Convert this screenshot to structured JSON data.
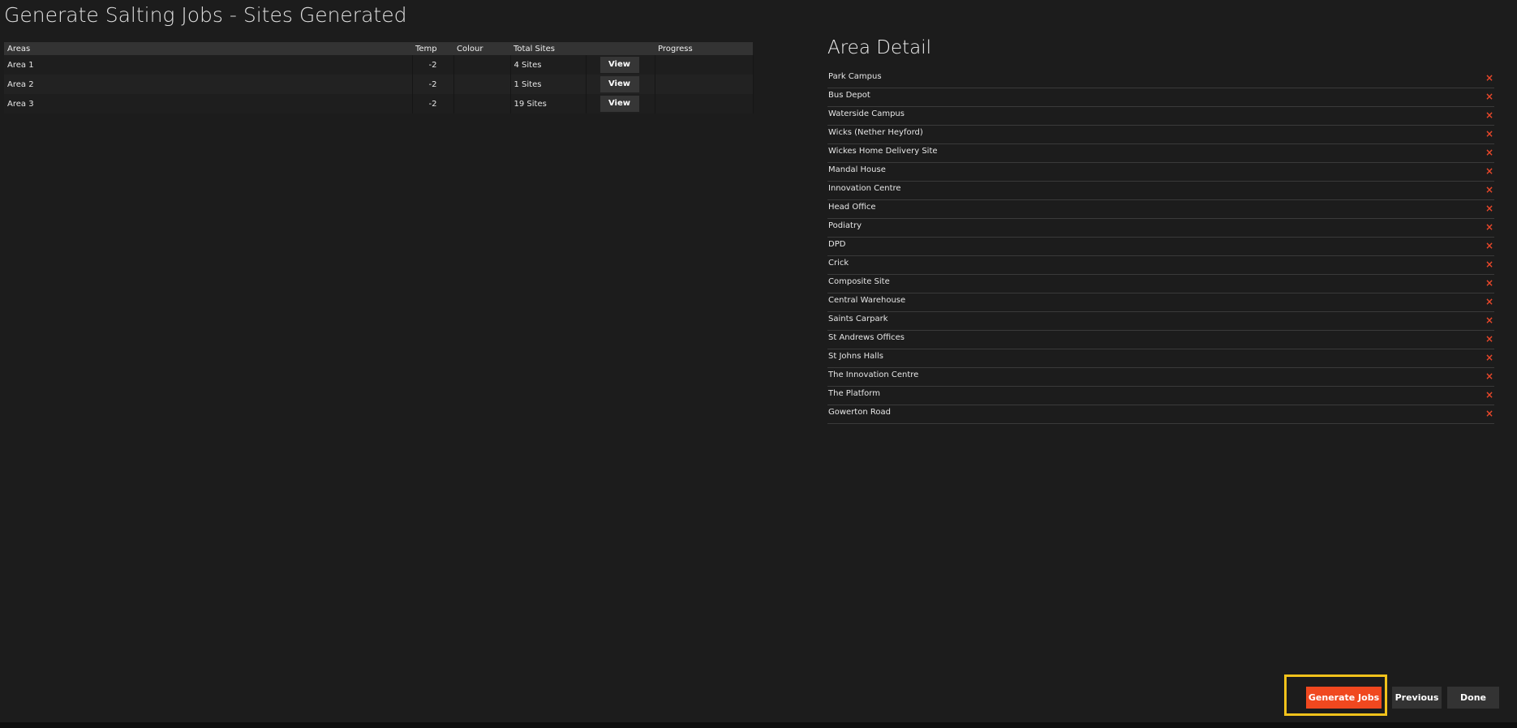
{
  "page": {
    "title": "Generate Salting Jobs - Sites Generated"
  },
  "areas_table": {
    "headers": {
      "areas": "Areas",
      "temp": "Temp",
      "colour": "Colour",
      "total_sites": "Total Sites",
      "action": "",
      "progress": "Progress"
    },
    "rows": [
      {
        "area": "Area 1",
        "temp": "-2",
        "colour": "",
        "total_sites": "4 Sites",
        "view_label": "View",
        "progress": ""
      },
      {
        "area": "Area 2",
        "temp": "-2",
        "colour": "",
        "total_sites": "1 Sites",
        "view_label": "View",
        "progress": ""
      },
      {
        "area": "Area 3",
        "temp": "-2",
        "colour": "",
        "total_sites": "19 Sites",
        "view_label": "View",
        "progress": ""
      }
    ]
  },
  "area_detail": {
    "title": "Area Detail",
    "remove_glyph": "×",
    "sites": [
      "Park Campus",
      "Bus Depot",
      "Waterside Campus",
      "Wicks (Nether Heyford)",
      "Wickes Home Delivery Site",
      "Mandal House",
      "Innovation Centre",
      "Head Office",
      "Podiatry",
      "DPD",
      "Crick",
      "Composite Site",
      "Central Warehouse",
      "Saints Carpark",
      "St Andrews Offices",
      "St Johns Halls",
      "The Innovation Centre",
      "The Platform",
      "Gowerton Road"
    ]
  },
  "footer": {
    "generate_label": "Generate Jobs",
    "previous_label": "Previous",
    "done_label": "Done"
  },
  "colors": {
    "background": "#1c1c1c",
    "accent": "#f0481f",
    "highlight": "#f2c21b",
    "remove_icon": "#e8472a"
  }
}
